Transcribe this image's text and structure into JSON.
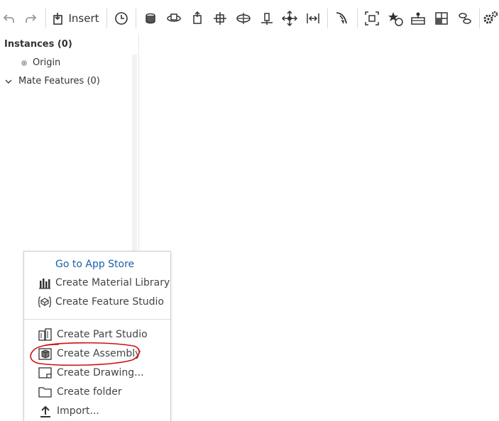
{
  "toolbar": {
    "insert_label": "Insert",
    "icons": [
      "undo-icon",
      "redo-icon",
      "insert-icon",
      "history-icon",
      "fastened-mate-icon",
      "revolute-mate-icon",
      "slider-mate-icon",
      "planar-mate-icon",
      "cylindrical-mate-icon",
      "pin-slot-mate-icon",
      "ball-mate-icon",
      "parallel-mate-icon",
      "tangent-mate-icon",
      "group-icon",
      "replicate-icon",
      "mate-connector-icon",
      "pattern-icon",
      "relations-icon",
      "settings-icon"
    ]
  },
  "panel": {
    "instances_title": "Instances (0)",
    "origin_label": "Origin",
    "mate_features_label": "Mate Features (0)"
  },
  "menu": {
    "app_store_label": "Go to App Store",
    "items": [
      {
        "label": "Create Material Library",
        "icon": "material-library-icon"
      },
      {
        "label": "Create Feature Studio",
        "icon": "feature-studio-icon"
      },
      {
        "label": "Create Part Studio",
        "icon": "part-studio-icon"
      },
      {
        "label": "Create Assembly",
        "icon": "assembly-icon"
      },
      {
        "label": "Create Drawing...",
        "icon": "drawing-icon"
      },
      {
        "label": "Create folder",
        "icon": "folder-icon"
      },
      {
        "label": "Import...",
        "icon": "import-icon"
      }
    ]
  },
  "colors": {
    "link": "#1a5ea8",
    "annotation": "#d01010"
  }
}
